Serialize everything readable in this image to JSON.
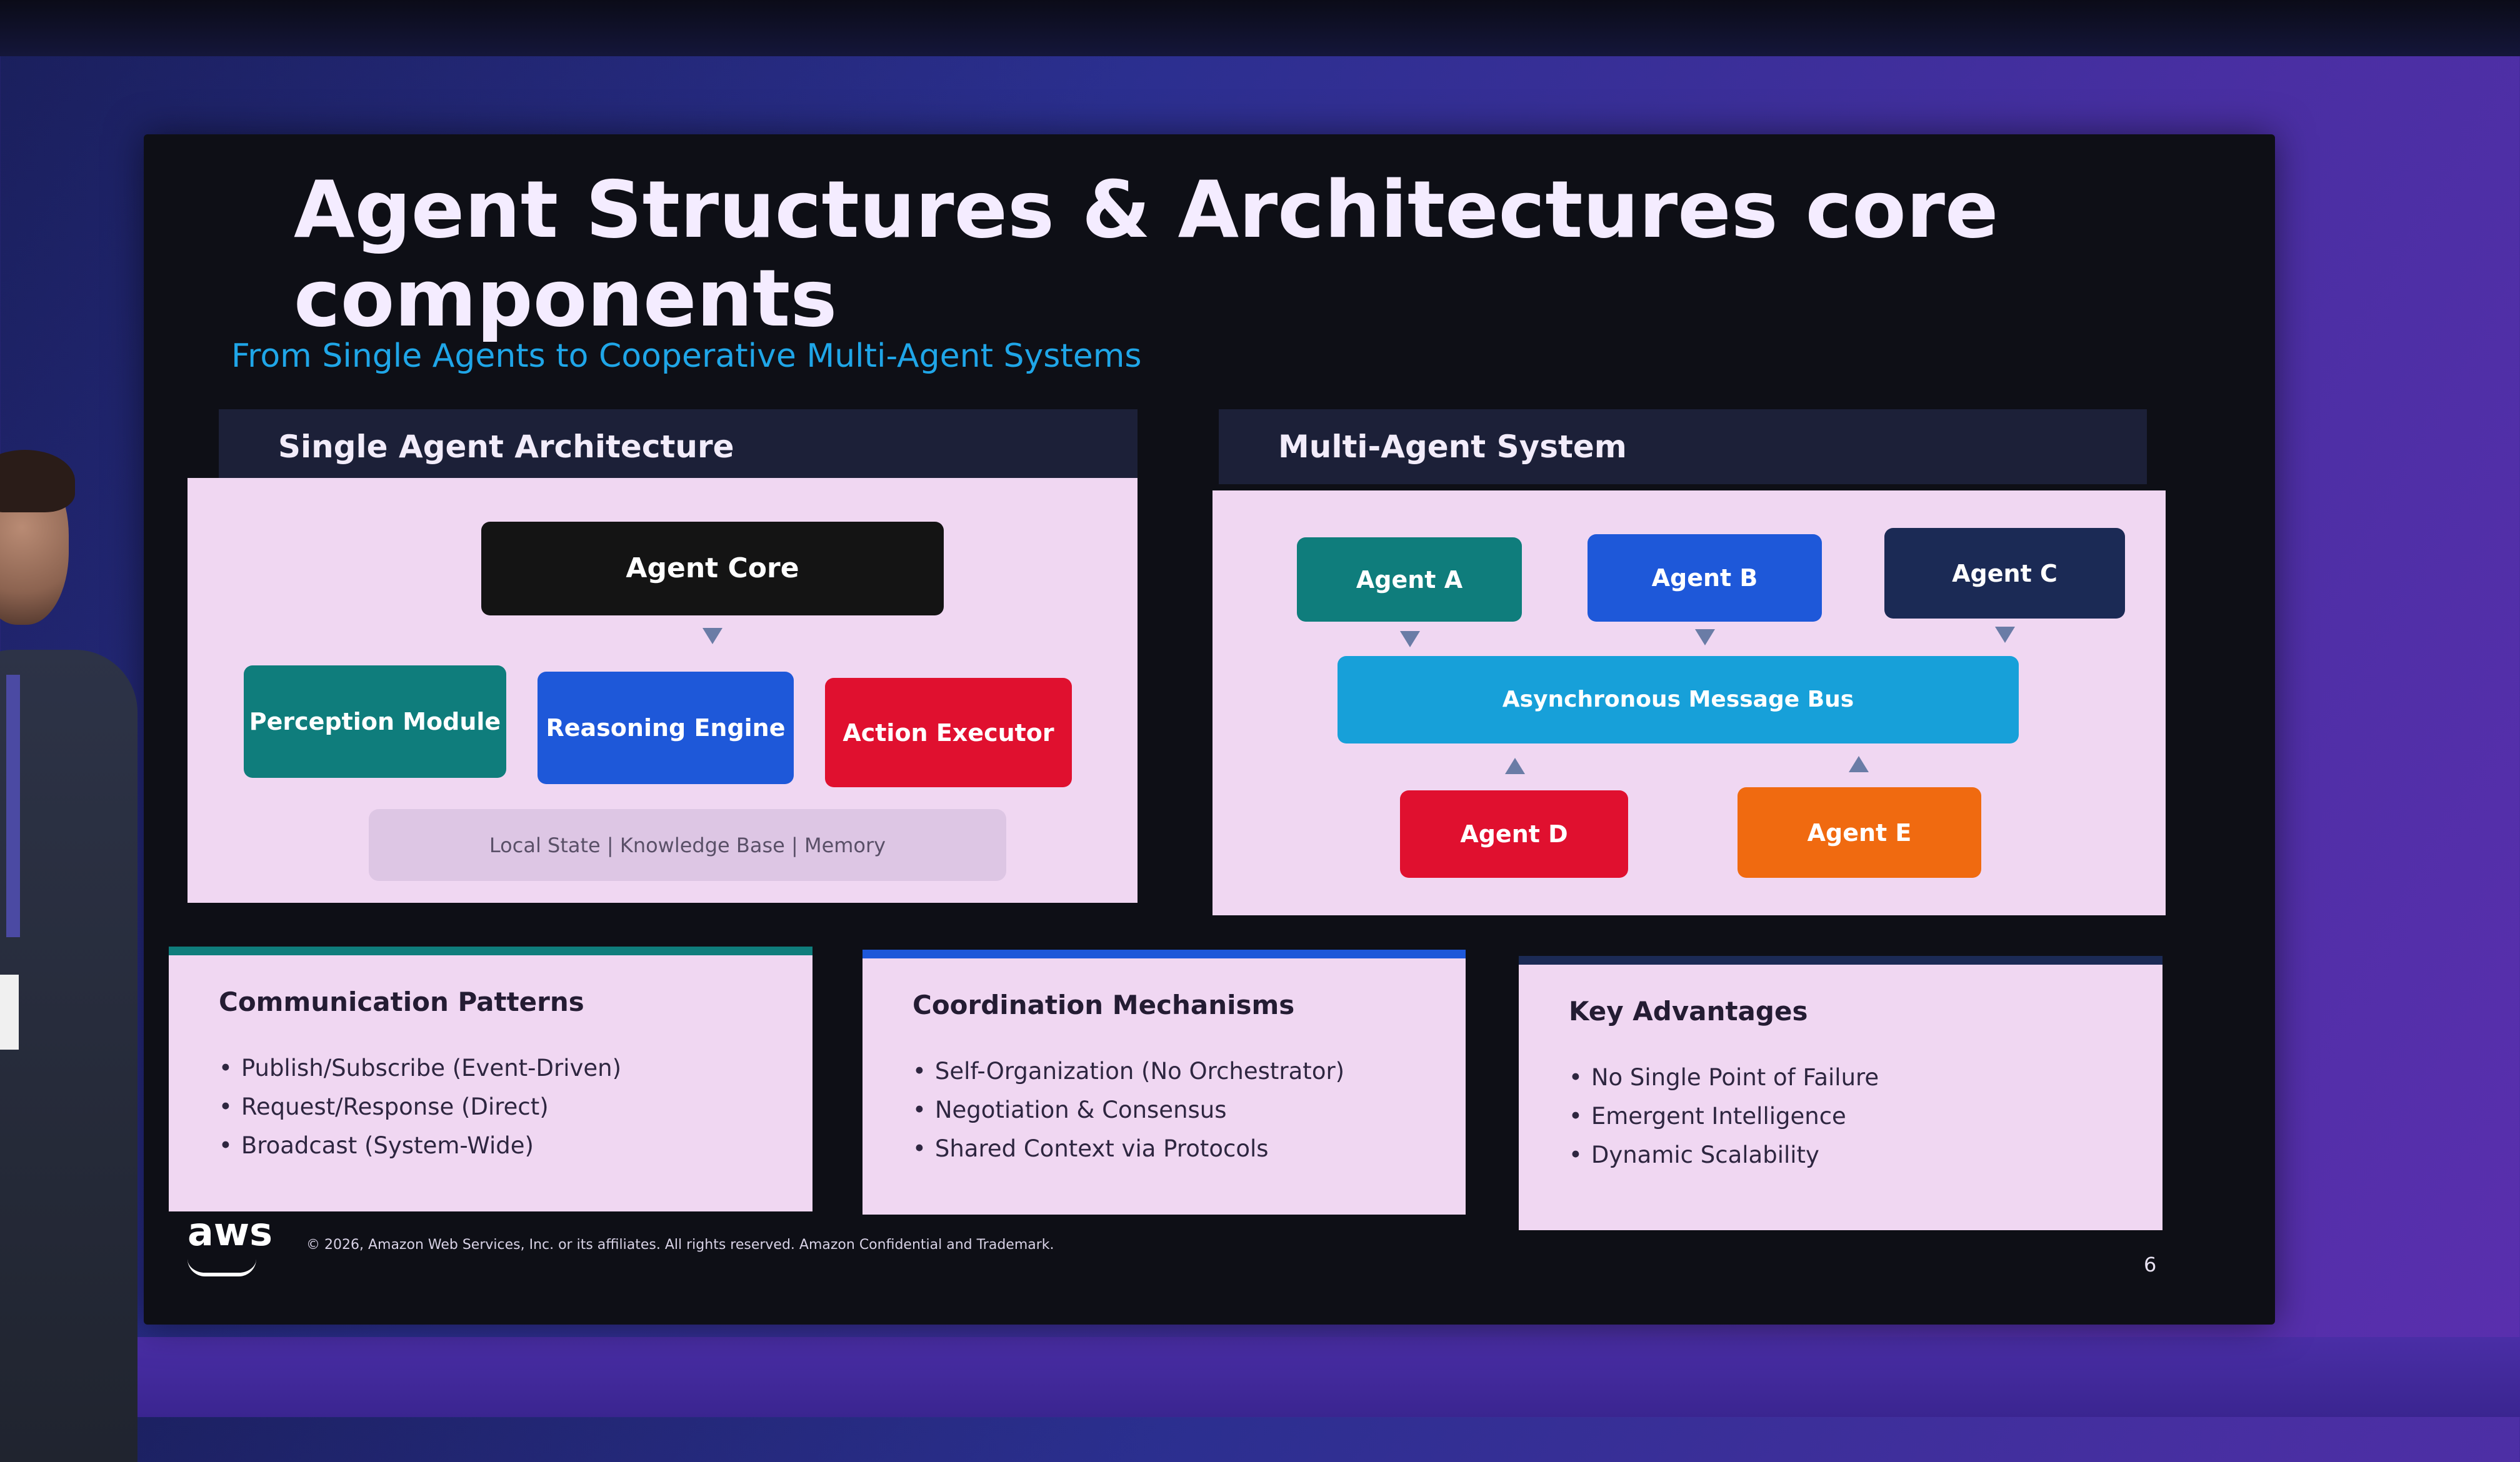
{
  "slide": {
    "title": "Agent Structures & Architectures core components",
    "subtitle": "From Single Agents to Cooperative Multi-Agent Systems",
    "single": {
      "heading": "Single Agent Architecture",
      "core": "Agent Core",
      "perception": "Perception Module",
      "reasoning": "Reasoning Engine",
      "action": "Action Executor",
      "memory": "Local State  |  Knowledge Base  |  Memory"
    },
    "multi": {
      "heading": "Multi-Agent System",
      "agent_a": "Agent A",
      "agent_b": "Agent B",
      "agent_c": "Agent C",
      "bus": "Asynchronous Message Bus",
      "agent_d": "Agent D",
      "agent_e": "Agent E"
    },
    "cards": [
      {
        "title": "Communication Patterns",
        "items": [
          "Publish/Subscribe (Event-Driven)",
          "Request/Response (Direct)",
          "Broadcast (System-Wide)"
        ]
      },
      {
        "title": "Coordination Mechanisms",
        "items": [
          "Self-Organization (No Orchestrator)",
          "Negotiation & Consensus",
          "Shared Context via Protocols"
        ]
      },
      {
        "title": "Key Advantages",
        "items": [
          "No Single Point of Failure",
          "Emergent Intelligence",
          "Dynamic Scalability"
        ]
      }
    ],
    "logo": "aws",
    "copyright": "© 2026, Amazon Web Services, Inc. or its affiliates. All rights reserved. Amazon Confidential and Trademark.",
    "page_number": "6"
  },
  "colors": {
    "teal": "#0f7d7c",
    "blue": "#1e58d9",
    "red": "#e0102f",
    "navy": "#1b2a55",
    "cyan": "#17a0d9",
    "orange": "#f06a10",
    "subtitle": "#1fa6e8"
  }
}
